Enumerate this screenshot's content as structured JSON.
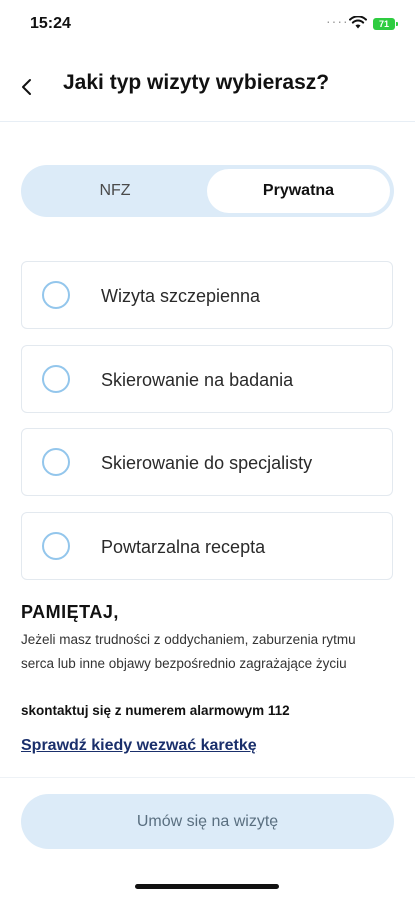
{
  "status_bar": {
    "time": "15:24",
    "battery": "71"
  },
  "header": {
    "title": "Jaki typ wizyty wybierasz?",
    "back_icon": "chevron-left-icon"
  },
  "segment": {
    "tabs": [
      {
        "label": "NFZ",
        "selected": false
      },
      {
        "label": "Prywatna",
        "selected": true
      }
    ]
  },
  "options": [
    {
      "label": "Wizyta szczepienna",
      "selected": false
    },
    {
      "label": "Skierowanie na badania",
      "selected": false
    },
    {
      "label": "Skierowanie do specjalisty",
      "selected": false
    },
    {
      "label": "Powtarzalna recepta",
      "selected": false
    }
  ],
  "notice": {
    "title": "PAMIĘTAJ,",
    "text": "Jeżeli masz trudności z oddychaniem, zaburzenia rytmu serca lub inne objawy bezpośrednio zagrażające życiu",
    "bold": "skontaktuj się z numerem alarmowym 112",
    "link": "Sprawdź kiedy wezwać karetkę"
  },
  "cta": {
    "label": "Umów się na wizytę"
  },
  "colors": {
    "accent_light": "#dcebf8",
    "radio_border": "#93c6ec",
    "link": "#1a2f6b",
    "battery": "#2ecc40"
  }
}
